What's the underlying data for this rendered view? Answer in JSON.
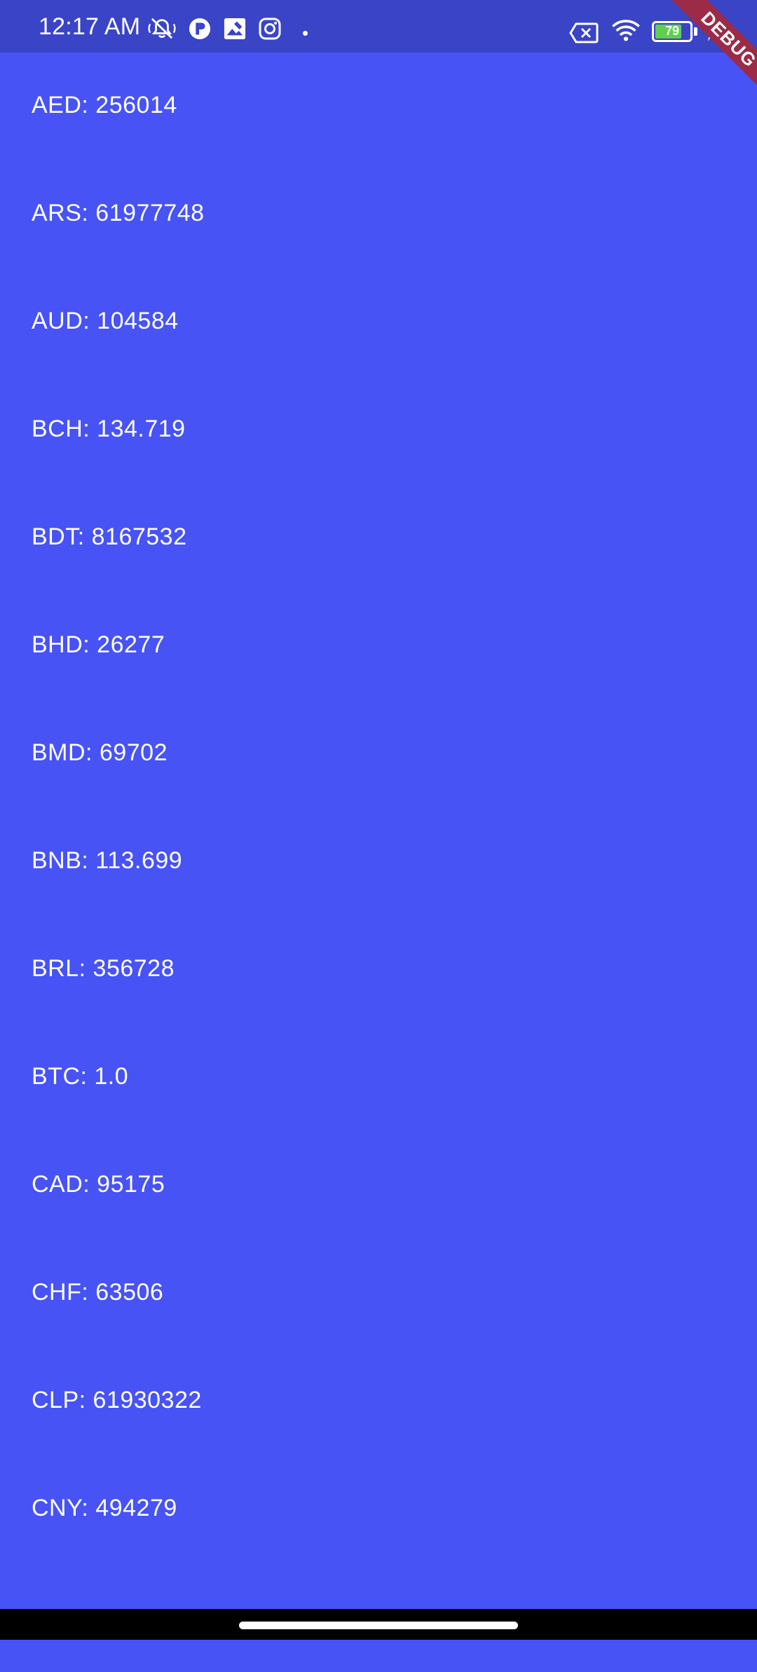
{
  "status_bar": {
    "time": "12:17 AM",
    "battery_level": "79",
    "battery_fraction": 0.79,
    "left_icons": [
      "notifications-muted-icon",
      "app-p-icon",
      "app-photo-icon",
      "instagram-icon",
      "more-notifications-dot"
    ],
    "right_icons": [
      "no-sim-icon",
      "wifi-icon",
      "battery-icon",
      "charging-bolt-icon"
    ]
  },
  "debug_banner": "DEBUG",
  "rates": [
    {
      "label": "AED: 256014"
    },
    {
      "label": "ARS: 61977748"
    },
    {
      "label": "AUD: 104584"
    },
    {
      "label": "BCH: 134.719"
    },
    {
      "label": "BDT: 8167532"
    },
    {
      "label": "BHD: 26277"
    },
    {
      "label": "BMD: 69702"
    },
    {
      "label": "BNB: 113.699"
    },
    {
      "label": "BRL: 356728"
    },
    {
      "label": "BTC: 1.0"
    },
    {
      "label": "CAD: 95175"
    },
    {
      "label": "CHF: 63506"
    },
    {
      "label": "CLP: 61930322"
    },
    {
      "label": "CNY: 494279"
    },
    {
      "label": ""
    }
  ],
  "colors": {
    "background": "#4753f5",
    "status_bar": "#3a44c7",
    "debug_banner": "#9b2b47",
    "battery_fill": "#5fd04c",
    "text": "#ffffff"
  }
}
